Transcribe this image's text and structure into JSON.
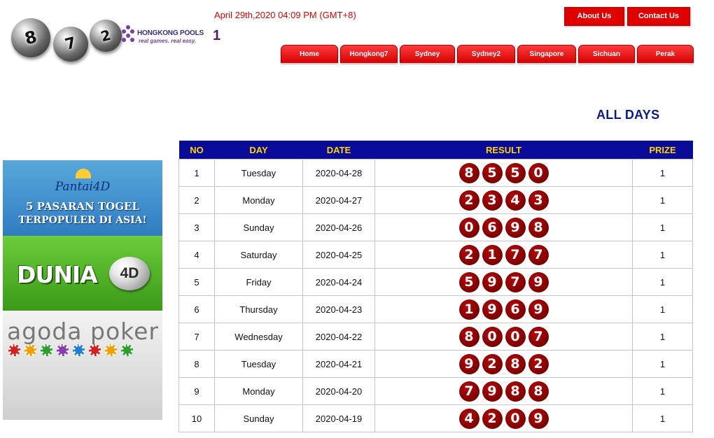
{
  "header": {
    "datetime": "April 29th,2020 04:09 PM (GMT+8)",
    "logo_balls": [
      "8",
      "7",
      "2"
    ],
    "brand_name": "HONGKONG POOLS",
    "brand_tagline": "real games. real easy.",
    "brand_suffix": "1",
    "top_links": [
      "About Us",
      "Contact Us"
    ],
    "tabs": [
      "Home",
      "Hongkong7",
      "Sydney",
      "Sydney2",
      "Singapore",
      "Sichuan",
      "Perak"
    ]
  },
  "section_title": "ALL DAYS",
  "banners": {
    "pantai": {
      "logo": "Pantai4D",
      "line1": "5 PASARAN TOGEL",
      "line2": "TERPOPULER DI ASIA!"
    },
    "dunia": {
      "text": "DUNIA",
      "ball": "4D"
    },
    "agoda": {
      "text": "agoda poker"
    }
  },
  "table": {
    "headers": [
      "NO",
      "DAY",
      "DATE",
      "RESULT",
      "PRIZE"
    ],
    "rows": [
      {
        "no": "1",
        "day": "Tuesday",
        "date": "2020-04-28",
        "result": [
          "8",
          "5",
          "5",
          "0"
        ],
        "prize": "1"
      },
      {
        "no": "2",
        "day": "Monday",
        "date": "2020-04-27",
        "result": [
          "2",
          "3",
          "4",
          "3"
        ],
        "prize": "1"
      },
      {
        "no": "3",
        "day": "Sunday",
        "date": "2020-04-26",
        "result": [
          "0",
          "6",
          "9",
          "8"
        ],
        "prize": "1"
      },
      {
        "no": "4",
        "day": "Saturday",
        "date": "2020-04-25",
        "result": [
          "2",
          "1",
          "7",
          "7"
        ],
        "prize": "1"
      },
      {
        "no": "5",
        "day": "Friday",
        "date": "2020-04-24",
        "result": [
          "5",
          "9",
          "7",
          "9"
        ],
        "prize": "1"
      },
      {
        "no": "6",
        "day": "Thursday",
        "date": "2020-04-23",
        "result": [
          "1",
          "9",
          "6",
          "9"
        ],
        "prize": "1"
      },
      {
        "no": "7",
        "day": "Wednesday",
        "date": "2020-04-22",
        "result": [
          "8",
          "0",
          "0",
          "7"
        ],
        "prize": "1"
      },
      {
        "no": "8",
        "day": "Tuesday",
        "date": "2020-04-21",
        "result": [
          "9",
          "2",
          "8",
          "2"
        ],
        "prize": "1"
      },
      {
        "no": "9",
        "day": "Monday",
        "date": "2020-04-20",
        "result": [
          "7",
          "9",
          "8",
          "8"
        ],
        "prize": "1"
      },
      {
        "no": "10",
        "day": "Sunday",
        "date": "2020-04-19",
        "result": [
          "4",
          "2",
          "0",
          "9"
        ],
        "prize": "1"
      }
    ]
  },
  "colors": {
    "accent_red": "#e00000",
    "header_blue": "#0b0b9a",
    "header_text_yellow": "#ffd700",
    "ball_maroon": "#8a0000",
    "title_blue": "#0b1a8a"
  }
}
